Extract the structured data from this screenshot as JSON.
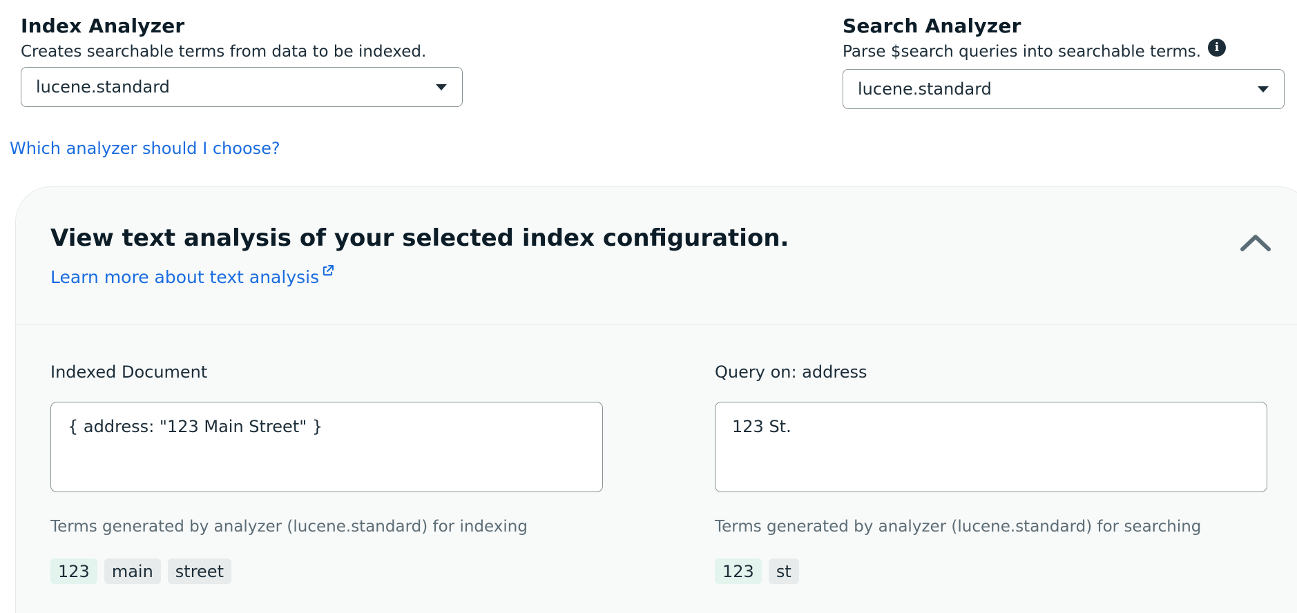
{
  "index_analyzer": {
    "title": "Index Analyzer",
    "description": "Creates searchable terms from data to be indexed.",
    "selected": "lucene.standard"
  },
  "search_analyzer": {
    "title": "Search Analyzer",
    "description": "Parse $search queries into searchable terms.",
    "selected": "lucene.standard",
    "info_icon": "info-icon"
  },
  "help_link": "Which analyzer should I choose?",
  "analysis_panel": {
    "title": "View text analysis of your selected index configuration.",
    "learn_more": "Learn more about text analysis",
    "collapse_icon": "chevron-up-icon",
    "indexed_document": {
      "label": "Indexed Document",
      "value": "{ address: \"123 Main Street\" }",
      "terms_label": "Terms generated by analyzer (lucene.standard) for indexing",
      "terms": [
        {
          "text": "123",
          "matched": true
        },
        {
          "text": "main",
          "matched": false
        },
        {
          "text": "street",
          "matched": false
        }
      ]
    },
    "query": {
      "label": "Query on: address",
      "value": "123 St.",
      "terms_label": "Terms generated by analyzer (lucene.standard) for searching",
      "terms": [
        {
          "text": "123",
          "matched": true
        },
        {
          "text": "st",
          "matched": false
        }
      ]
    }
  },
  "colors": {
    "link": "#1a6ce0",
    "matched_term_bg": "#e3f4ee",
    "term_bg": "#e8ebeb",
    "panel_bg": "#f8fafa"
  }
}
